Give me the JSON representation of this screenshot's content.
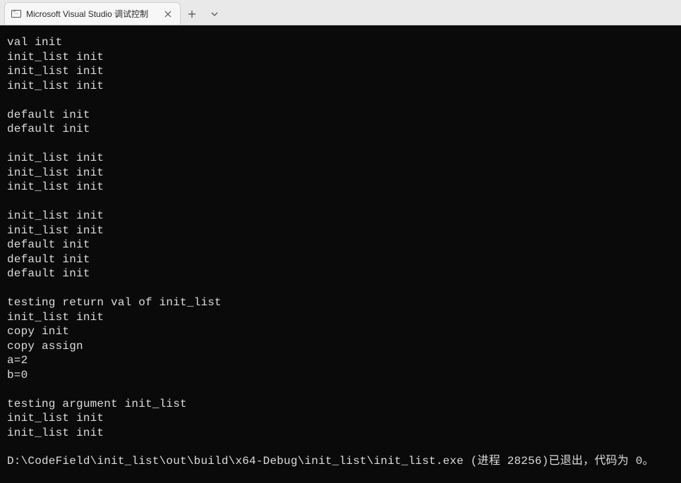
{
  "tab": {
    "title": "Microsoft Visual Studio 调试控制",
    "icon_name": "cmd-icon",
    "close_label": "Close"
  },
  "tabbar": {
    "new_tab_label": "New tab",
    "dropdown_label": "Tab options"
  },
  "console": {
    "lines": [
      "val init",
      "init_list init",
      "init_list init",
      "init_list init",
      "",
      "default init",
      "default init",
      "",
      "init_list init",
      "init_list init",
      "init_list init",
      "",
      "init_list init",
      "init_list init",
      "default init",
      "default init",
      "default init",
      "",
      "testing return val of init_list",
      "init_list init",
      "copy init",
      "copy assign",
      "a=2",
      "b=0",
      "",
      "testing argument init_list",
      "init_list init",
      "init_list init"
    ],
    "exit_line": "D:\\CodeField\\init_list\\out\\build\\x64-Debug\\init_list\\init_list.exe (进程 28256)已退出，代码为 0。"
  }
}
